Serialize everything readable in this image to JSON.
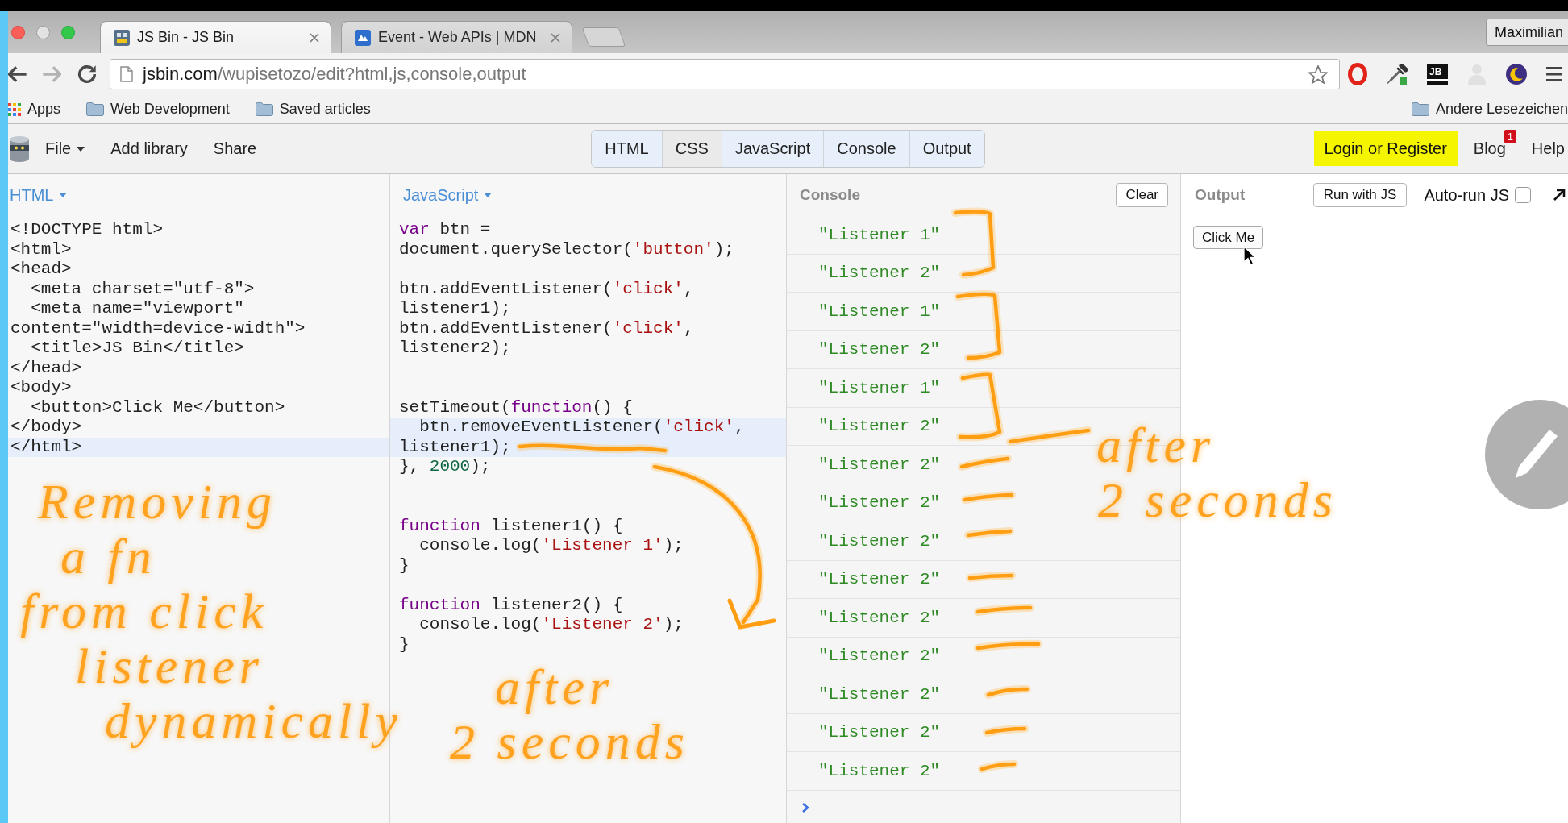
{
  "browser": {
    "tabs": [
      {
        "title": "JS Bin - JS Bin",
        "selected": true
      },
      {
        "title": "Event - Web APIs | MDN",
        "selected": false
      }
    ],
    "profile": "Maximilian",
    "url": {
      "host": "jsbin.com",
      "path": "/wupisetozo/edit?html,js,console,output"
    },
    "extension_label": "JB",
    "bookmarks": [
      {
        "label": "Apps",
        "kind": "apps"
      },
      {
        "label": "Web Development",
        "kind": "folder"
      },
      {
        "label": "Saved articles",
        "kind": "folder"
      }
    ],
    "other_bookmarks": {
      "label": "Andere Lesezeichen",
      "kind": "folder"
    }
  },
  "toolbar": {
    "menu": [
      {
        "label": "File",
        "dropdown": true
      },
      {
        "label": "Add library",
        "dropdown": false
      },
      {
        "label": "Share",
        "dropdown": false
      }
    ],
    "panel_tabs": [
      {
        "label": "HTML",
        "selected": true
      },
      {
        "label": "CSS",
        "selected": false
      },
      {
        "label": "JavaScript",
        "selected": true
      },
      {
        "label": "Console",
        "selected": true
      },
      {
        "label": "Output",
        "selected": true
      }
    ],
    "login": "Login or Register",
    "blog": {
      "label": "Blog",
      "badge": "1"
    },
    "help": "Help"
  },
  "panels": {
    "html": {
      "title": "HTML",
      "dropdown": true,
      "lines": [
        {
          "kind": "code",
          "text": "<!DOCTYPE html>",
          "active": false
        },
        {
          "kind": "code",
          "text": "<html>",
          "active": false
        },
        {
          "kind": "code",
          "text": "<head>",
          "active": false
        },
        {
          "kind": "code",
          "text": "  <meta charset=\"utf-8\">",
          "active": false
        },
        {
          "kind": "code",
          "text": "  <meta name=\"viewport\"",
          "active": false
        },
        {
          "kind": "code",
          "text": "content=\"width=device-width\">",
          "active": false
        },
        {
          "kind": "code",
          "text": "  <title>JS Bin</title>",
          "active": false
        },
        {
          "kind": "code",
          "text": "</head>",
          "active": false
        },
        {
          "kind": "code",
          "text": "<body>",
          "active": false
        },
        {
          "kind": "code",
          "text": "  <button>Click Me</button>",
          "active": false
        },
        {
          "kind": "code",
          "text": "</body>",
          "active": false
        },
        {
          "kind": "code",
          "text": "</html>",
          "active": true
        }
      ]
    },
    "javascript": {
      "title": "JavaScript",
      "dropdown": true,
      "lines": [
        {
          "kind": "code",
          "active": false,
          "segments": [
            {
              "kind": "keyword",
              "text": "var"
            },
            {
              "kind": "plain",
              "text": " btn ="
            }
          ]
        },
        {
          "kind": "code",
          "active": false,
          "segments": [
            {
              "kind": "plain",
              "text": "document.querySelector("
            },
            {
              "kind": "string",
              "text": "'button'"
            },
            {
              "kind": "plain",
              "text": ");"
            }
          ]
        },
        {
          "kind": "blank",
          "active": false
        },
        {
          "kind": "code",
          "active": false,
          "segments": [
            {
              "kind": "plain",
              "text": "btn.addEventListener("
            },
            {
              "kind": "string",
              "text": "'click'"
            },
            {
              "kind": "plain",
              "text": ","
            }
          ]
        },
        {
          "kind": "code",
          "active": false,
          "segments": [
            {
              "kind": "plain",
              "text": "listener1);"
            }
          ]
        },
        {
          "kind": "code",
          "active": false,
          "segments": [
            {
              "kind": "plain",
              "text": "btn.addEventListener("
            },
            {
              "kind": "string",
              "text": "'click'"
            },
            {
              "kind": "plain",
              "text": ","
            }
          ]
        },
        {
          "kind": "code",
          "active": false,
          "segments": [
            {
              "kind": "plain",
              "text": "listener2);"
            }
          ]
        },
        {
          "kind": "blank",
          "active": false
        },
        {
          "kind": "blank",
          "active": false
        },
        {
          "kind": "code",
          "active": false,
          "segments": [
            {
              "kind": "plain",
              "text": "setTimeout("
            },
            {
              "kind": "keyword",
              "text": "function"
            },
            {
              "kind": "plain",
              "text": "() {"
            }
          ]
        },
        {
          "kind": "code",
          "active": true,
          "segments": [
            {
              "kind": "plain",
              "text": "  btn.removeEventListener("
            },
            {
              "kind": "string",
              "text": "'click'"
            },
            {
              "kind": "plain",
              "text": ","
            }
          ]
        },
        {
          "kind": "code",
          "active": true,
          "segments": [
            {
              "kind": "plain",
              "text": "listener1);"
            }
          ]
        },
        {
          "kind": "code",
          "active": false,
          "segments": [
            {
              "kind": "plain",
              "text": "}, "
            },
            {
              "kind": "number",
              "text": "2000"
            },
            {
              "kind": "plain",
              "text": ");"
            }
          ]
        },
        {
          "kind": "blank",
          "active": false
        },
        {
          "kind": "blank",
          "active": false
        },
        {
          "kind": "code",
          "active": false,
          "segments": [
            {
              "kind": "keyword",
              "text": "function"
            },
            {
              "kind": "plain",
              "text": " listener1() {"
            }
          ]
        },
        {
          "kind": "code",
          "active": false,
          "segments": [
            {
              "kind": "plain",
              "text": "  console.log("
            },
            {
              "kind": "string",
              "text": "'Listener 1'"
            },
            {
              "kind": "plain",
              "text": ");"
            }
          ]
        },
        {
          "kind": "code",
          "active": false,
          "segments": [
            {
              "kind": "plain",
              "text": "}"
            }
          ]
        },
        {
          "kind": "blank",
          "active": false
        },
        {
          "kind": "code",
          "active": false,
          "segments": [
            {
              "kind": "keyword",
              "text": "function"
            },
            {
              "kind": "plain",
              "text": " listener2() {"
            }
          ]
        },
        {
          "kind": "code",
          "active": false,
          "segments": [
            {
              "kind": "plain",
              "text": "  console.log("
            },
            {
              "kind": "string",
              "text": "'Listener 2'"
            },
            {
              "kind": "plain",
              "text": ");"
            }
          ]
        },
        {
          "kind": "code",
          "active": false,
          "segments": [
            {
              "kind": "plain",
              "text": "}"
            }
          ]
        }
      ]
    },
    "console": {
      "title": "Console",
      "dropdown": false,
      "clear": "Clear",
      "entries": [
        "\"Listener 1\"",
        "\"Listener 2\"",
        "\"Listener 1\"",
        "\"Listener 2\"",
        "\"Listener 1\"",
        "\"Listener 2\"",
        "\"Listener 2\"",
        "\"Listener 2\"",
        "\"Listener 2\"",
        "\"Listener 2\"",
        "\"Listener 2\"",
        "\"Listener 2\"",
        "\"Listener 2\"",
        "\"Listener 2\"",
        "\"Listener 2\""
      ]
    },
    "output": {
      "title": "Output",
      "dropdown": false,
      "run": "Run with JS",
      "autorun": {
        "label": "Auto-run JS",
        "checked": false
      },
      "preview_button": "Click Me"
    }
  },
  "annotations": [
    {
      "lines": [
        "Removing",
        "a fn",
        "from click",
        "listener",
        "dynamically"
      ]
    },
    {
      "lines": [
        "after",
        "2 seconds"
      ]
    },
    {
      "lines": [
        "after",
        "2 seconds"
      ]
    }
  ]
}
